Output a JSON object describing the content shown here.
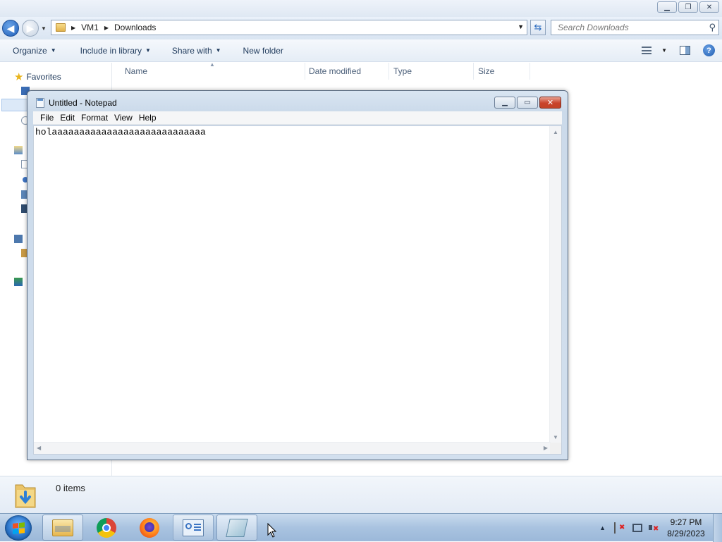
{
  "explorer": {
    "breadcrumb": [
      "VM1",
      "Downloads"
    ],
    "search_placeholder": "Search Downloads",
    "commands": {
      "organize": "Organize",
      "include_in_library": "Include in library",
      "share_with": "Share with",
      "new_folder": "New folder"
    },
    "nav": {
      "favorites": "Favorites"
    },
    "columns": [
      "Name",
      "Date modified",
      "Type",
      "Size"
    ],
    "status": {
      "items": "0 items"
    }
  },
  "notepad": {
    "title": "Untitled - Notepad",
    "menu": [
      "File",
      "Edit",
      "Format",
      "View",
      "Help"
    ],
    "content": "holaaaaaaaaaaaaaaaaaaaaaaaaaaaa"
  },
  "taskbar": {
    "apps": [
      "windows-explorer",
      "google-chrome",
      "firefox",
      "control-panel",
      "notepad"
    ],
    "clock": {
      "time": "9:27 PM",
      "date": "8/29/2023"
    }
  },
  "colors": {
    "accent": "#1e395b",
    "taskbar": "#a9c3e0",
    "close_button": "#c9432a"
  }
}
